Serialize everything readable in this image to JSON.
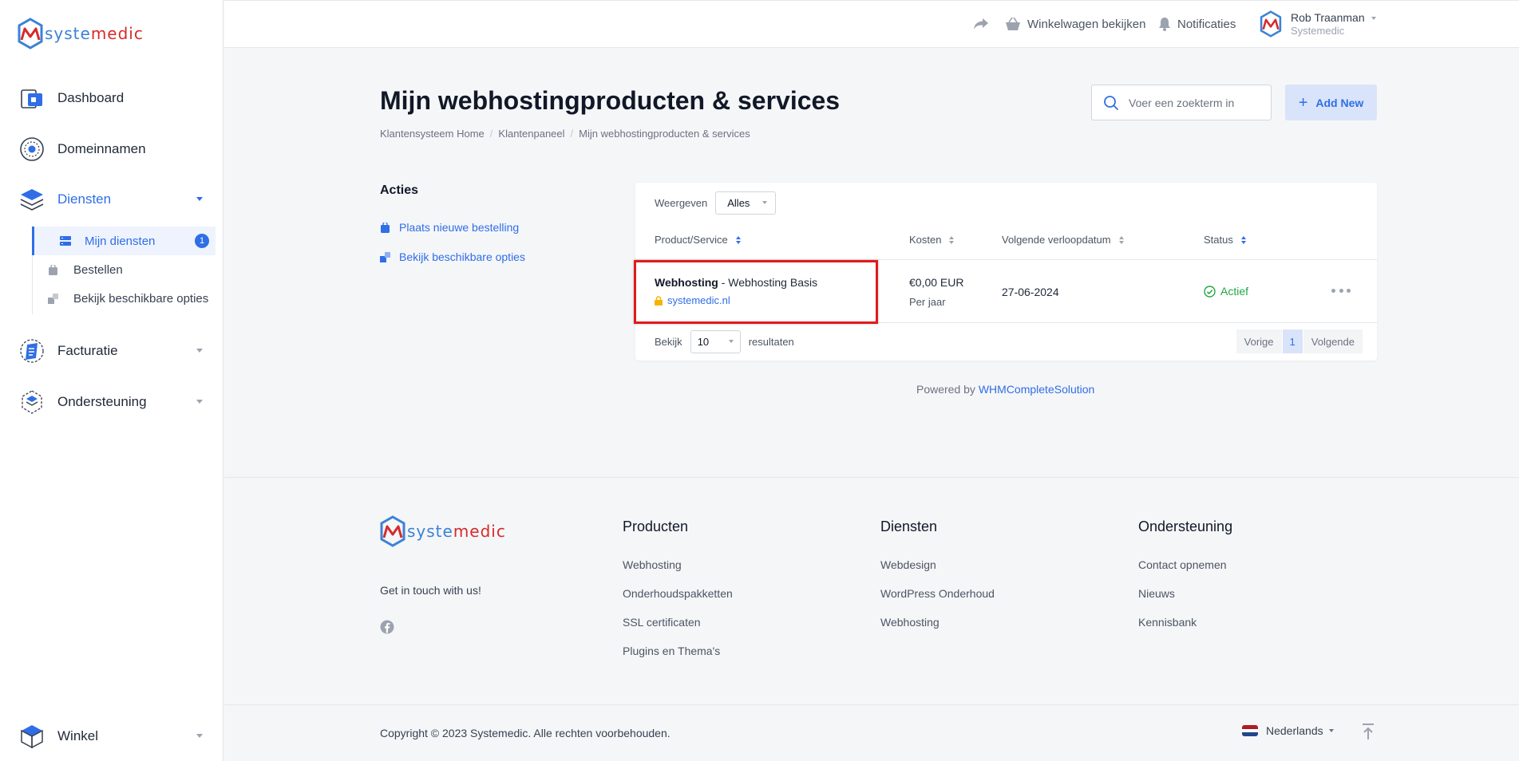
{
  "brand": {
    "part_a": "syste",
    "part_b": "medic",
    "colors": {
      "blue": "#3b82d6",
      "red": "#d62b2b"
    }
  },
  "sidebar": {
    "items": [
      {
        "label": "Dashboard",
        "icon": "dashboard-icon"
      },
      {
        "label": "Domeinnamen",
        "icon": "globe-icon"
      },
      {
        "label": "Diensten",
        "icon": "layers-icon"
      },
      {
        "label": "Facturatie",
        "icon": "invoice-icon"
      },
      {
        "label": "Ondersteuning",
        "icon": "support-icon"
      },
      {
        "label": "Winkel",
        "icon": "cube-icon"
      }
    ],
    "sub_items": [
      {
        "label": "Mijn diensten",
        "badge": "1",
        "icon": "server-icon"
      },
      {
        "label": "Bestellen",
        "icon": "cart-icon"
      },
      {
        "label": "Bekijk beschikbare opties",
        "icon": "options-icon"
      }
    ]
  },
  "topbar": {
    "share_icon": "share-icon",
    "cart_label": "Winkelwagen bekijken",
    "notifications_label": "Notificaties",
    "user_name": "Rob Traanman",
    "user_company": "Systemedic"
  },
  "page": {
    "title": "Mijn webhostingproducten & services",
    "breadcrumb": [
      "Klantensysteem Home",
      "Klantenpaneel",
      "Mijn webhostingproducten & services"
    ],
    "search_placeholder": "Voer een zoekterm in",
    "add_new_label": "Add New"
  },
  "acties": {
    "title": "Acties",
    "links": [
      "Plaats nieuwe bestelling",
      "Bekijk beschikbare opties"
    ]
  },
  "table": {
    "filter_label": "Weergeven",
    "filter_value": "Alles",
    "headers": [
      "Product/Service",
      "Kosten",
      "Volgende verloopdatum",
      "Status"
    ],
    "rows": [
      {
        "product": "Webhosting",
        "plan": " - Webhosting Basis",
        "domain": "systemedic.nl",
        "price": "€0,00 EUR",
        "cycle": "Per jaar",
        "next_due": "27-06-2024",
        "status": "Actief"
      }
    ],
    "show_label": "Bekijk",
    "show_value": "10",
    "results_label": "resultaten",
    "prev_label": "Vorige",
    "current_page": "1",
    "next_label": "Volgende"
  },
  "powered": {
    "prefix": "Powered by ",
    "link": "WHMCompleteSolution"
  },
  "footer": {
    "tagline": "Get in touch with us!",
    "columns": [
      {
        "title": "Producten",
        "links": [
          "Webhosting",
          "Onderhoudspakketten",
          "SSL certificaten",
          "Plugins en Thema's"
        ]
      },
      {
        "title": "Diensten",
        "links": [
          "Webdesign",
          "WordPress Onderhoud",
          "Webhosting"
        ]
      },
      {
        "title": "Ondersteuning",
        "links": [
          "Contact opnemen",
          "Nieuws",
          "Kennisbank"
        ]
      }
    ],
    "copyright": "Copyright © 2023 Systemedic. Alle rechten voorbehouden.",
    "language": "Nederlands"
  },
  "colors": {
    "accent": "#2f6ee6",
    "active": "#22a845",
    "highlight": "#e01b1b"
  }
}
